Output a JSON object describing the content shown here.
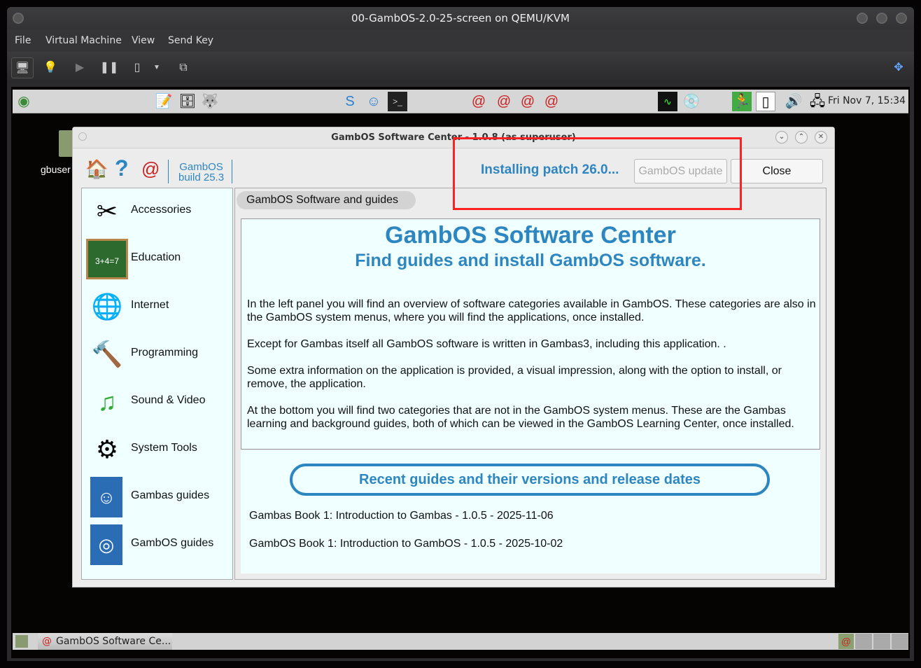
{
  "vm": {
    "title": "00-GambOS-2.0-25-screen on QEMU/KVM",
    "menu": [
      "File",
      "Virtual Machine",
      "View",
      "Send Key"
    ]
  },
  "panel": {
    "clock": "Fri Nov 7, 15:34",
    "launcher_caption": "GambOS"
  },
  "desktop": {
    "icon_label": "gbuser"
  },
  "app": {
    "title": "GambOS Software Center - 1.0.8 (as superuser)",
    "build_line1": "GambOS",
    "build_line2": "build 25.3",
    "status": "Installing patch 26.0...",
    "update_button": "GambOS update",
    "close_button": "Close",
    "categories": [
      {
        "label": "Accessories",
        "icon": "scissors-ruler-icon"
      },
      {
        "label": "Education",
        "icon": "chalkboard-icon"
      },
      {
        "label": "Internet",
        "icon": "globe-icon"
      },
      {
        "label": "Programming",
        "icon": "hammer-notebook-icon"
      },
      {
        "label": "Sound & Video",
        "icon": "music-film-icon"
      },
      {
        "label": "System Tools",
        "icon": "monitor-gear-icon"
      },
      {
        "label": "Gambas guides",
        "icon": "book-icon"
      },
      {
        "label": "GambOS guides",
        "icon": "book-icon"
      }
    ],
    "tab": "GambOS Software and guides",
    "heading": "GambOS Software Center",
    "subheading": "Find guides and install GambOS software.",
    "paragraphs": [
      "In the left panel you will find an overview of software categories available in GambOS. These categories are also in the GambOS system menus, where you will find the applications, once installed.",
      "Except for Gambas itself all GambOS software is written in Gambas3, including this application. .",
      "Some extra information on the application is provided, a visual impression, along with the option to install, or remove, the application.",
      "At the bottom you will find two categories that are not in the GambOS system menus. These are the Gambas learning and background guides, both of which can be viewed in the GambOS Learning Center, once installed."
    ],
    "recent_title": "Recent guides and their versions and release dates",
    "guides": [
      "Gambas Book 1: Introduction to Gambas - 1.0.5 - 2025-11-06",
      "GambOS Book 1: Introduction to GambOS - 1.0.5 - 2025-10-02"
    ]
  },
  "taskbar": {
    "task": "GambOS Software Ce..."
  },
  "colors": {
    "accent": "#2e86c1",
    "highlight": "#ff2222",
    "panel_bg": "#f0ffff"
  }
}
